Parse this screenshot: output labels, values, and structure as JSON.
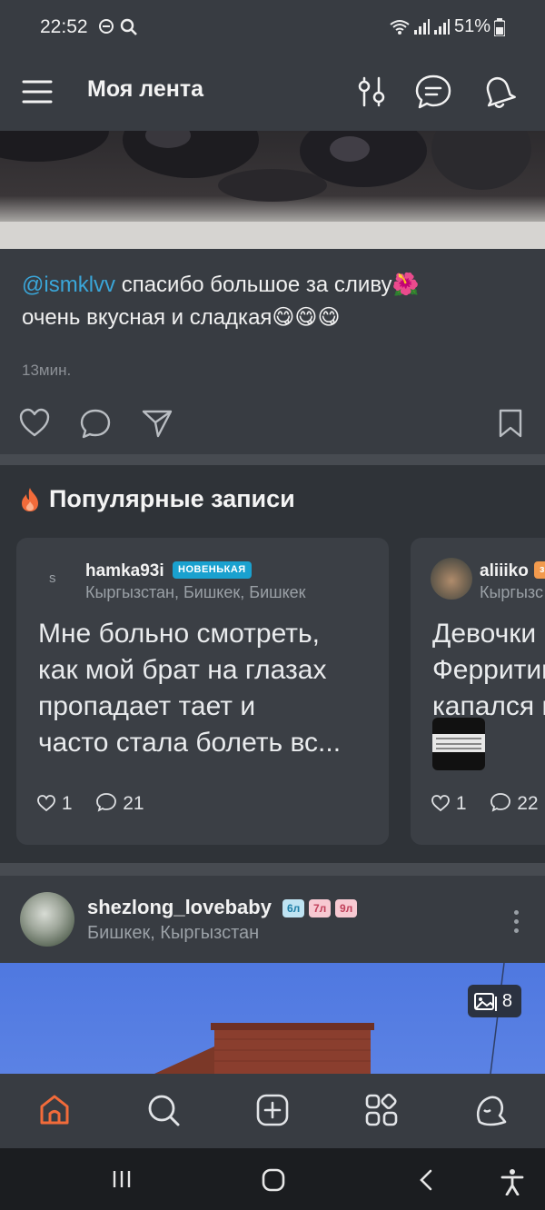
{
  "status_bar": {
    "time": "22:52",
    "battery": "51%"
  },
  "header": {
    "title": "Моя лента",
    "icons": [
      "menu-icon",
      "filter-icon",
      "chat-icon",
      "bell-icon"
    ]
  },
  "post1": {
    "mention": "@ismklvv",
    "text_line1": " спасибо большое за сливу🌺",
    "text_line2": "очень вкусная и сладкая😋😋😋",
    "time": "13мин."
  },
  "popular": {
    "title": "Популярные записи",
    "cards": [
      {
        "avatar_letter": "s",
        "username": "hamka93i",
        "badge": "НОВЕНЬКАЯ",
        "location": "Кыргызстан, Бишкек, Бишкек",
        "text": [
          "Мне больно смотреть,",
          "как мой брат на глазах",
          "пропадает тает и",
          "часто стала болеть вс..."
        ],
        "likes": "1",
        "comments": "21"
      },
      {
        "username": "aliiiko",
        "badge": "з",
        "location": "Кыргызс",
        "text": [
          "Девочки ,",
          "Ферритин",
          "капался и"
        ],
        "likes": "1",
        "comments": "22"
      }
    ]
  },
  "post2": {
    "username": "shezlong_lovebaby",
    "ages": [
      "6л",
      "7л",
      "9л"
    ],
    "location": "Бишкек, Кыргызстан",
    "photo_count": "8"
  },
  "bottom_nav": [
    "home-icon",
    "search-icon",
    "add-icon",
    "services-icon",
    "profile-icon"
  ],
  "colors": {
    "accent_orange": "#f26b3a",
    "mention_blue": "#3aa6d9",
    "badge_blue": "#1aa1cf"
  }
}
